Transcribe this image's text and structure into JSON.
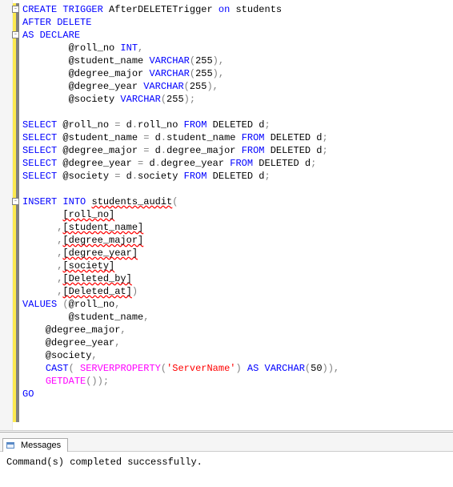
{
  "code": {
    "lines": [
      {
        "tokens": [
          {
            "t": "CREATE",
            "c": "kw"
          },
          {
            "t": " ",
            "c": "plain"
          },
          {
            "t": "TRIGGER",
            "c": "kw"
          },
          {
            "t": " AfterDELETETrigger ",
            "c": "plain"
          },
          {
            "t": "on",
            "c": "kw"
          },
          {
            "t": " students",
            "c": "plain"
          }
        ],
        "box": true
      },
      {
        "tokens": [
          {
            "t": "AFTER",
            "c": "kw"
          },
          {
            "t": " ",
            "c": "plain"
          },
          {
            "t": "DELETE",
            "c": "kw"
          }
        ]
      },
      {
        "tokens": [
          {
            "t": "AS",
            "c": "kw"
          },
          {
            "t": " ",
            "c": "plain"
          },
          {
            "t": "DECLARE",
            "c": "kw"
          }
        ],
        "box": true
      },
      {
        "tokens": [
          {
            "t": "        @roll_no ",
            "c": "plain"
          },
          {
            "t": "INT",
            "c": "kw"
          },
          {
            "t": ",",
            "c": "grey"
          }
        ]
      },
      {
        "tokens": [
          {
            "t": "        @student_name ",
            "c": "plain"
          },
          {
            "t": "VARCHAR",
            "c": "kw"
          },
          {
            "t": "(",
            "c": "grey"
          },
          {
            "t": "255",
            "c": "plain"
          },
          {
            "t": "),",
            "c": "grey"
          }
        ]
      },
      {
        "tokens": [
          {
            "t": "        @degree_major ",
            "c": "plain"
          },
          {
            "t": "VARCHAR",
            "c": "kw"
          },
          {
            "t": "(",
            "c": "grey"
          },
          {
            "t": "255",
            "c": "plain"
          },
          {
            "t": "),",
            "c": "grey"
          }
        ]
      },
      {
        "tokens": [
          {
            "t": "        @degree_year ",
            "c": "plain"
          },
          {
            "t": "VARCHAR",
            "c": "kw"
          },
          {
            "t": "(",
            "c": "grey"
          },
          {
            "t": "255",
            "c": "plain"
          },
          {
            "t": "),",
            "c": "grey"
          }
        ]
      },
      {
        "tokens": [
          {
            "t": "        @society ",
            "c": "plain"
          },
          {
            "t": "VARCHAR",
            "c": "kw"
          },
          {
            "t": "(",
            "c": "grey"
          },
          {
            "t": "255",
            "c": "plain"
          },
          {
            "t": ");",
            "c": "grey"
          }
        ]
      },
      {
        "tokens": [
          {
            "t": "",
            "c": "plain"
          }
        ]
      },
      {
        "tokens": [
          {
            "t": "SELECT",
            "c": "kw"
          },
          {
            "t": " @roll_no ",
            "c": "plain"
          },
          {
            "t": "=",
            "c": "grey"
          },
          {
            "t": " d",
            "c": "plain"
          },
          {
            "t": ".",
            "c": "grey"
          },
          {
            "t": "roll_no ",
            "c": "plain"
          },
          {
            "t": "FROM",
            "c": "kw"
          },
          {
            "t": " DELETED d",
            "c": "plain"
          },
          {
            "t": ";",
            "c": "grey"
          }
        ]
      },
      {
        "tokens": [
          {
            "t": "SELECT",
            "c": "kw"
          },
          {
            "t": " @student_name ",
            "c": "plain"
          },
          {
            "t": "=",
            "c": "grey"
          },
          {
            "t": " d",
            "c": "plain"
          },
          {
            "t": ".",
            "c": "grey"
          },
          {
            "t": "student_name ",
            "c": "plain"
          },
          {
            "t": "FROM",
            "c": "kw"
          },
          {
            "t": " DELETED d",
            "c": "plain"
          },
          {
            "t": ";",
            "c": "grey"
          }
        ]
      },
      {
        "tokens": [
          {
            "t": "SELECT",
            "c": "kw"
          },
          {
            "t": " @degree_major ",
            "c": "plain"
          },
          {
            "t": "=",
            "c": "grey"
          },
          {
            "t": " d",
            "c": "plain"
          },
          {
            "t": ".",
            "c": "grey"
          },
          {
            "t": "degree_major ",
            "c": "plain"
          },
          {
            "t": "FROM",
            "c": "kw"
          },
          {
            "t": " DELETED d",
            "c": "plain"
          },
          {
            "t": ";",
            "c": "grey"
          }
        ]
      },
      {
        "tokens": [
          {
            "t": "SELECT",
            "c": "kw"
          },
          {
            "t": " @degree_year ",
            "c": "plain"
          },
          {
            "t": "=",
            "c": "grey"
          },
          {
            "t": " d",
            "c": "plain"
          },
          {
            "t": ".",
            "c": "grey"
          },
          {
            "t": "degree_year ",
            "c": "plain"
          },
          {
            "t": "FROM",
            "c": "kw"
          },
          {
            "t": " DELETED d",
            "c": "plain"
          },
          {
            "t": ";",
            "c": "grey"
          }
        ]
      },
      {
        "tokens": [
          {
            "t": "SELECT",
            "c": "kw"
          },
          {
            "t": " @society ",
            "c": "plain"
          },
          {
            "t": "=",
            "c": "grey"
          },
          {
            "t": " d",
            "c": "plain"
          },
          {
            "t": ".",
            "c": "grey"
          },
          {
            "t": "society ",
            "c": "plain"
          },
          {
            "t": "FROM",
            "c": "kw"
          },
          {
            "t": " DELETED d",
            "c": "plain"
          },
          {
            "t": ";",
            "c": "grey"
          }
        ]
      },
      {
        "tokens": [
          {
            "t": "",
            "c": "plain"
          }
        ]
      },
      {
        "tokens": [
          {
            "t": "INSERT",
            "c": "kw"
          },
          {
            "t": " ",
            "c": "plain"
          },
          {
            "t": "INTO",
            "c": "kw"
          },
          {
            "t": " ",
            "c": "plain"
          },
          {
            "t": "students_audit",
            "c": "obj"
          },
          {
            "t": "(",
            "c": "grey"
          }
        ],
        "box": true
      },
      {
        "tokens": [
          {
            "t": "       ",
            "c": "plain"
          },
          {
            "t": "[roll_no]",
            "c": "obj"
          }
        ]
      },
      {
        "tokens": [
          {
            "t": "      ",
            "c": "plain"
          },
          {
            "t": ",",
            "c": "grey"
          },
          {
            "t": "[student_name]",
            "c": "obj"
          }
        ]
      },
      {
        "tokens": [
          {
            "t": "      ",
            "c": "plain"
          },
          {
            "t": ",",
            "c": "grey"
          },
          {
            "t": "[degree_major]",
            "c": "obj"
          }
        ]
      },
      {
        "tokens": [
          {
            "t": "      ",
            "c": "plain"
          },
          {
            "t": ",",
            "c": "grey"
          },
          {
            "t": "[degree_year]",
            "c": "obj"
          }
        ]
      },
      {
        "tokens": [
          {
            "t": "      ",
            "c": "plain"
          },
          {
            "t": ",",
            "c": "grey"
          },
          {
            "t": "[society]",
            "c": "obj"
          }
        ]
      },
      {
        "tokens": [
          {
            "t": "      ",
            "c": "plain"
          },
          {
            "t": ",",
            "c": "grey"
          },
          {
            "t": "[Deleted_by]",
            "c": "obj"
          }
        ]
      },
      {
        "tokens": [
          {
            "t": "      ",
            "c": "plain"
          },
          {
            "t": ",",
            "c": "grey"
          },
          {
            "t": "[Deleted_at]",
            "c": "obj"
          },
          {
            "t": ")",
            "c": "grey"
          }
        ]
      },
      {
        "tokens": [
          {
            "t": "VALUES",
            "c": "kw"
          },
          {
            "t": " ",
            "c": "plain"
          },
          {
            "t": "(",
            "c": "grey"
          },
          {
            "t": "@roll_no",
            "c": "plain"
          },
          {
            "t": ",",
            "c": "grey"
          }
        ]
      },
      {
        "tokens": [
          {
            "t": "        @student_name",
            "c": "plain"
          },
          {
            "t": ",",
            "c": "grey"
          }
        ]
      },
      {
        "tokens": [
          {
            "t": "    @degree_major",
            "c": "plain"
          },
          {
            "t": ",",
            "c": "grey"
          }
        ]
      },
      {
        "tokens": [
          {
            "t": "    @degree_year",
            "c": "plain"
          },
          {
            "t": ",",
            "c": "grey"
          }
        ]
      },
      {
        "tokens": [
          {
            "t": "    @society",
            "c": "plain"
          },
          {
            "t": ",",
            "c": "grey"
          }
        ]
      },
      {
        "tokens": [
          {
            "t": "    ",
            "c": "plain"
          },
          {
            "t": "CAST",
            "c": "kw"
          },
          {
            "t": "(",
            "c": "grey"
          },
          {
            "t": " ",
            "c": "plain"
          },
          {
            "t": "SERVERPROPERTY",
            "c": "sys"
          },
          {
            "t": "(",
            "c": "grey"
          },
          {
            "t": "'ServerName'",
            "c": "str"
          },
          {
            "t": ")",
            "c": "grey"
          },
          {
            "t": " ",
            "c": "plain"
          },
          {
            "t": "AS",
            "c": "kw"
          },
          {
            "t": " ",
            "c": "plain"
          },
          {
            "t": "VARCHAR",
            "c": "kw"
          },
          {
            "t": "(",
            "c": "grey"
          },
          {
            "t": "50",
            "c": "plain"
          },
          {
            "t": ")),",
            "c": "grey"
          }
        ]
      },
      {
        "tokens": [
          {
            "t": "    ",
            "c": "plain"
          },
          {
            "t": "GETDATE",
            "c": "sys"
          },
          {
            "t": "());",
            "c": "grey"
          }
        ]
      },
      {
        "tokens": [
          {
            "t": "GO",
            "c": "kw"
          }
        ]
      }
    ]
  },
  "messages": {
    "tab_label": "Messages",
    "body": "Command(s) completed successfully."
  }
}
